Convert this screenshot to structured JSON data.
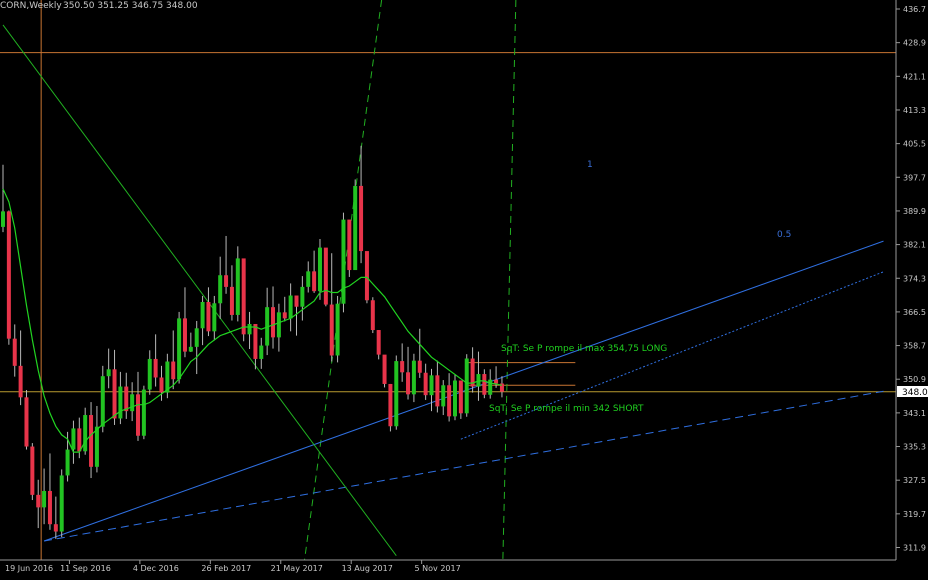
{
  "header": {
    "symbol_label": "CORN,Weekly",
    "ohlc_label": "350.50 351.25 346.75 348.00"
  },
  "colors": {
    "background": "#000000",
    "bull_candle": "#22c322",
    "bear_candle": "#e8344a",
    "wick": "#b9b9b9",
    "ma_line": "#21d421",
    "trend_blue": "#2f6fe0",
    "fib_orange": "#c87432",
    "green_dashed": "#21b021",
    "axis_text": "#c8c8c8",
    "annotation_green": "#20d020",
    "fib_label_blue": "#3a6fd8"
  },
  "chart_data": {
    "type": "candlestick",
    "instrument": "CORN",
    "timeframe": "Weekly",
    "last_price": "348.0",
    "ylim": [
      310.0,
      438.0
    ],
    "y_tick_labels": [
      "436.7",
      "428.9",
      "421.1",
      "413.3",
      "405.5",
      "397.7",
      "389.9",
      "382.1",
      "374.3",
      "366.5",
      "358.7",
      "350.9",
      "343.1",
      "335.3",
      "327.5",
      "319.7",
      "311.9"
    ],
    "x_tick_labels": [
      "19 Jun 2016",
      "11 Sep 2016",
      "4 Dec 2016",
      "26 Feb 2017",
      "21 May 2017",
      "13 Aug 2017",
      "5 Nov 2017"
    ],
    "ohlc": [
      [
        386.2,
        400.6,
        385.0,
        389.8
      ],
      [
        389.8,
        390.0,
        358.9,
        360.3
      ],
      [
        360.3,
        363.6,
        351.5,
        354.0
      ],
      [
        354.0,
        362.2,
        344.9,
        346.7
      ],
      [
        346.7,
        348.4,
        334.6,
        335.3
      ],
      [
        335.3,
        336.1,
        322.9,
        324.1
      ],
      [
        324.1,
        327.6,
        316.4,
        321.2
      ],
      [
        321.2,
        330.2,
        317.3,
        325.0
      ],
      [
        325.0,
        333.7,
        316.0,
        317.3
      ],
      [
        317.3,
        323.7,
        313.9,
        315.6
      ],
      [
        315.6,
        330.0,
        314.3,
        328.6
      ],
      [
        328.6,
        338.7,
        327.2,
        334.6
      ],
      [
        334.6,
        341.3,
        331.3,
        339.5
      ],
      [
        339.5,
        342.0,
        332.6,
        334.2
      ],
      [
        334.2,
        344.3,
        333.4,
        342.6
      ],
      [
        342.6,
        345.6,
        328.0,
        330.6
      ],
      [
        330.6,
        344.7,
        329.3,
        339.9
      ],
      [
        339.9,
        354.0,
        338.6,
        351.6
      ],
      [
        351.6,
        358.0,
        348.8,
        353.2
      ],
      [
        353.2,
        357.7,
        340.3,
        341.8
      ],
      [
        341.8,
        352.6,
        340.5,
        349.2
      ],
      [
        349.2,
        352.4,
        341.7,
        343.5
      ],
      [
        343.5,
        350.2,
        341.2,
        347.4
      ],
      [
        347.4,
        352.6,
        336.6,
        337.8
      ],
      [
        337.8,
        349.4,
        337.0,
        348.5
      ],
      [
        348.5,
        357.6,
        347.3,
        355.6
      ],
      [
        355.6,
        361.3,
        349.2,
        351.3
      ],
      [
        351.3,
        354.0,
        345.9,
        347.8
      ],
      [
        347.8,
        356.8,
        346.5,
        355.0
      ],
      [
        355.0,
        362.2,
        348.6,
        350.9
      ],
      [
        350.9,
        366.5,
        349.9,
        365.0
      ],
      [
        365.0,
        372.2,
        356.0,
        357.3
      ],
      [
        357.3,
        361.7,
        357.2,
        358.4
      ],
      [
        358.4,
        364.4,
        352.1,
        362.7
      ],
      [
        362.7,
        370.2,
        358.8,
        368.8
      ],
      [
        368.8,
        372.2,
        360.9,
        362.0
      ],
      [
        362.0,
        370.2,
        359.9,
        368.5
      ],
      [
        368.5,
        379.3,
        364.9,
        375.0
      ],
      [
        375.0,
        384.1,
        370.7,
        372.3
      ],
      [
        372.3,
        377.3,
        364.5,
        365.8
      ],
      [
        365.8,
        381.7,
        364.3,
        378.9
      ],
      [
        378.9,
        378.3,
        359.7,
        361.3
      ],
      [
        361.3,
        366.5,
        357.9,
        363.7
      ],
      [
        363.7,
        363.6,
        353.2,
        355.6
      ],
      [
        355.6,
        360.5,
        353.3,
        358.7
      ],
      [
        358.7,
        372.1,
        356.5,
        367.6
      ],
      [
        367.6,
        372.4,
        358.0,
        360.6
      ],
      [
        360.6,
        368.4,
        357.3,
        366.4
      ],
      [
        366.4,
        370.0,
        364.3,
        365.0
      ],
      [
        365.0,
        373.1,
        362.0,
        370.3
      ],
      [
        370.3,
        370.2,
        361.0,
        367.7
      ],
      [
        367.7,
        374.8,
        364.5,
        372.3
      ],
      [
        372.3,
        378.2,
        371.0,
        375.9
      ],
      [
        375.9,
        380.7,
        370.9,
        371.3
      ],
      [
        371.3,
        383.4,
        369.3,
        381.4
      ],
      [
        381.4,
        379.5,
        367.8,
        368.2
      ],
      [
        368.2,
        380.1,
        355.0,
        356.4
      ],
      [
        356.4,
        370.2,
        354.8,
        368.4
      ],
      [
        368.4,
        389.5,
        366.4,
        387.9
      ],
      [
        387.9,
        384.9,
        374.6,
        376.2
      ],
      [
        376.2,
        397.2,
        376.3,
        395.7
      ],
      [
        395.7,
        405.0,
        377.8,
        380.6
      ],
      [
        380.6,
        380.5,
        368.5,
        369.2
      ],
      [
        369.2,
        369.9,
        361.6,
        362.3
      ],
      [
        362.3,
        362.3,
        355.5,
        356.6
      ],
      [
        356.6,
        356.5,
        349.0,
        349.8
      ],
      [
        349.8,
        349.8,
        338.8,
        340.0
      ],
      [
        340.0,
        356.4,
        339.2,
        355.1
      ],
      [
        355.1,
        359.2,
        350.3,
        352.5
      ],
      [
        352.5,
        358.4,
        346.2,
        347.4
      ],
      [
        347.4,
        356.8,
        345.6,
        355.2
      ],
      [
        355.2,
        362.6,
        351.2,
        352.4
      ],
      [
        352.4,
        354.5,
        346.1,
        347.2
      ],
      [
        347.2,
        353.3,
        343.5,
        351.8
      ],
      [
        351.8,
        355.2,
        343.2,
        344.6
      ],
      [
        344.6,
        350.7,
        342.6,
        349.5
      ],
      [
        349.5,
        352.3,
        341.1,
        342.3
      ],
      [
        342.3,
        352.1,
        341.4,
        350.6
      ],
      [
        350.6,
        350.4,
        341.7,
        343.0
      ],
      [
        343.0,
        356.7,
        342.2,
        355.7
      ],
      [
        355.7,
        358.3,
        347.8,
        349.2
      ],
      [
        349.2,
        357.3,
        345.9,
        352.1
      ],
      [
        352.1,
        353.2,
        346.5,
        347.3
      ],
      [
        347.3,
        353.2,
        346.4,
        350.8
      ],
      [
        350.8,
        353.9,
        348.9,
        349.9
      ],
      [
        349.9,
        351.6,
        346.7,
        348.0
      ]
    ],
    "series": [
      {
        "name": "",
        "type": "moving_average",
        "values": [
          395.0,
          392.0,
          386.0,
          377.0,
          368.0,
          360.0,
          353.0,
          347.0,
          343.0,
          340.0,
          338.0,
          337.0,
          334.0,
          334.0,
          336.5,
          338.0,
          339.2,
          340.5,
          341.5,
          342.5,
          343.5,
          344.0,
          344.5,
          345.0,
          345.0,
          345.5,
          346.5,
          347.5,
          348.5,
          349.5,
          351.0,
          353.0,
          355.0,
          356.0,
          357.5,
          359.0,
          360.0,
          361.0,
          361.5,
          362.0,
          362.5,
          363.0,
          363.0,
          363.0,
          362.5,
          363.0,
          363.5,
          364.0,
          364.5,
          365.0,
          366.0,
          367.0,
          368.0,
          369.0,
          371.0,
          371.5,
          371.0,
          371.0,
          372.0,
          372.5,
          373.5,
          374.5,
          374.5,
          373.0,
          371.5,
          370.0,
          368.0,
          366.0,
          364.0,
          362.0,
          360.5,
          359.0,
          357.5,
          356.0,
          355.0,
          354.0,
          353.0,
          352.0,
          351.0,
          350.0,
          350.0,
          350.5,
          350.5,
          350.0,
          349.8,
          349.5
        ]
      }
    ],
    "trendlines": [
      {
        "style": "solid",
        "color": "blue",
        "from": [
          7,
          313.4
        ],
        "to": [
          150,
          382.9
        ]
      },
      {
        "style": "dashed",
        "color": "blue",
        "from": [
          7,
          313.4
        ],
        "to": [
          150,
          348.1
        ]
      },
      {
        "style": "dotted",
        "color": "blue",
        "from": [
          78,
          337.0
        ],
        "to": [
          150,
          375.8
        ]
      },
      {
        "style": "solid",
        "color": "green",
        "from": [
          0,
          433.0
        ],
        "to": [
          67,
          310.0
        ]
      }
    ],
    "horizontal_levels": [
      {
        "price": 426.6,
        "color": "orange",
        "extent": "full"
      },
      {
        "price": 354.75,
        "color": "orange",
        "extent": "short"
      },
      {
        "price": 349.5,
        "color": "orange",
        "extent": "short"
      },
      {
        "price": 348.0,
        "color": "gold",
        "extent": "full"
      }
    ],
    "vertical_lines": [
      {
        "bar": 6.5,
        "style": "solid",
        "color": "orange"
      },
      {
        "bar": 87.2,
        "style": "dashed",
        "color": "green"
      },
      {
        "bar": 64.5,
        "style": "dashed",
        "color": "green",
        "slanted_to_bar": 50.0
      }
    ],
    "annotations": {
      "fib_label_1": "1",
      "fib_label_05": "0.5",
      "long_text": "SqT: Se P rompe il max 354,75 LONG",
      "short_text": "SqT: Se P rompe il min 342 SHORT"
    }
  }
}
